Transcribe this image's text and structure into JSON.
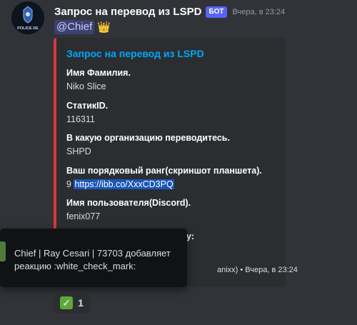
{
  "message": {
    "author": "Запрос на перевод из LSPD",
    "bot_tag": "БОТ",
    "timestamp": "Вчера, в 23:24",
    "mention": "@Chief",
    "crown_emoji": "👑",
    "avatar_text": "POLICE DE"
  },
  "embed": {
    "accent_color": "#da373c",
    "title": "Запрос на перевод из LSPD",
    "fields": [
      {
        "name": "Имя Фамилия.",
        "value": "Niko Slice"
      },
      {
        "name": "СтатикID.",
        "value": "116311"
      },
      {
        "name": "В какую организацию переводитесь.",
        "value": "SHPD"
      },
      {
        "name": "Ваш порядковый ранг(скриншот планшета).",
        "value_prefix": "9 ",
        "value_link": "https://ibb.co/XxxCD3PQ"
      },
      {
        "name": "Имя пользователя(Discord).",
        "value": "fenix077"
      },
      {
        "name_partial": "у:"
      }
    ],
    "footer_partial": "anixx) • Вчера, в 23:24"
  },
  "reaction": {
    "emoji": "✓",
    "emoji_name": "white-check-mark",
    "count": "1"
  },
  "tooltip": {
    "text": "Chief | Ray Cesari | 73703 добавляет реакцию :white_check_mark:"
  }
}
